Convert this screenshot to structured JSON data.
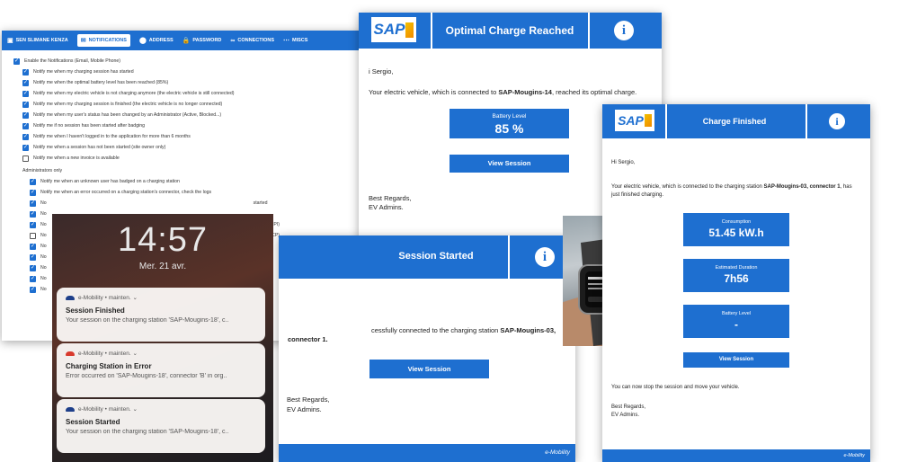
{
  "settings": {
    "tabs": [
      {
        "icon": "▣",
        "label": "SEN SLIMANE KENZA"
      },
      {
        "icon": "✉",
        "label": "NOTIFICATIONS"
      },
      {
        "icon": "⬤",
        "label": "ADDRESS"
      },
      {
        "icon": "🔒",
        "label": "PASSWORD"
      },
      {
        "icon": "∞",
        "label": "CONNECTIONS"
      },
      {
        "icon": "⋯",
        "label": "MISCS"
      }
    ],
    "enable_label": "Enable the Notifications (Email, Mobile Phone)",
    "user_items": [
      {
        "checked": true,
        "label": "Notify me when my charging session has started"
      },
      {
        "checked": true,
        "label": "Notify me when the optimal battery level has been reached (85%)"
      },
      {
        "checked": true,
        "label": "Notify me when my electric vehicle is not charging anymore (the electric vehicle is still connected)"
      },
      {
        "checked": true,
        "label": "Notify me when my charging session is finished (the electric vehicle is no longer connected)"
      },
      {
        "checked": true,
        "label": "Notify me when my user's status has been changed by an Administrator (Active, Blocked...)"
      },
      {
        "checked": true,
        "label": "Notify me if no session has been started after badging"
      },
      {
        "checked": true,
        "label": "Notify me when I haven't logged in to the application for more than 6 months"
      },
      {
        "checked": true,
        "label": "Notify me when a session has not been started (site owner only)"
      },
      {
        "checked": false,
        "label": "Notify me when a new invoice is available"
      }
    ],
    "admin_heading": "Administrators only",
    "admin_items": [
      {
        "checked": true,
        "label": "Notify me when an unknown user has badged on a charging station"
      },
      {
        "checked": true,
        "label": "Notify me when an error occurred on a charging station's connector, check the logs"
      },
      {
        "checked": true,
        "label": "No",
        "tail": "started"
      },
      {
        "checked": true,
        "label": "No",
        "tail": ""
      },
      {
        "checked": true,
        "label": "No",
        "tail": "tform (OCPI)"
      },
      {
        "checked": false,
        "label": "No",
        "tail": "tform (OICP)"
      },
      {
        "checked": true,
        "label": "No",
        "tail": ""
      },
      {
        "checked": true,
        "label": "No",
        "tail": ""
      },
      {
        "checked": true,
        "label": "No",
        "tail": ""
      },
      {
        "checked": true,
        "label": "No",
        "tail": ""
      },
      {
        "checked": true,
        "label": "No",
        "tail": ""
      }
    ]
  },
  "lockscreen": {
    "time": "14:57",
    "date": "Mer. 21 avr.",
    "notifications": [
      {
        "app": "e-Mobility • mainten.",
        "title": "Session Finished",
        "body": "Your session on the charging station 'SAP-Mougins-18', c..",
        "color": "#1e3f8a"
      },
      {
        "app": "e-Mobility • mainten.",
        "title": "Charging Station in Error",
        "body": "Error occurred on 'SAP-Mougins-18', connector 'B' in org..",
        "color": "#d83a2e"
      },
      {
        "app": "e-Mobility • mainten.",
        "title": "Session Started",
        "body": "Your session on the charging station 'SAP-Mougins-18', c..",
        "color": "#1e3f8a"
      }
    ]
  },
  "mail_optimal": {
    "logo": "SAP",
    "title": "Optimal Charge Reached",
    "greeting": "i Sergio,",
    "line_pre": "Your electric vehicle, which is connected to ",
    "line_station": "SAP-Mougins-14",
    "line_post": ", reached its optimal charge.",
    "battery_label": "Battery Level",
    "battery_value": "85 %",
    "button": "View Session",
    "regards": "Best Regards,",
    "signature": "EV Admins."
  },
  "mail_started": {
    "title": "Session Started",
    "line_pre": "cessfully connected to the charging station ",
    "line_station": "SAP-Mougins-03,",
    "connector": "connector 1.",
    "button": "View Session",
    "regards": "Best Regards,",
    "signature": "EV Admins.",
    "footer": "e-Mobility"
  },
  "mail_finished": {
    "logo": "SAP",
    "title": "Charge Finished",
    "greeting": "Hi Sergio,",
    "line_pre": "Your electric vehicle, which is connected to the charging station ",
    "line_station": "SAP-Mougins-03,",
    "line_connector": "connector 1",
    "line_post": ", has just finished charging.",
    "consumption_label": "Consumption",
    "consumption_value": "51.45 kW.h",
    "duration_label": "Estimated Duration",
    "duration_value": "7h56",
    "battery_label": "Battery Level",
    "battery_value": "-",
    "button": "View Session",
    "closing": "You can now stop the session and move your vehicle.",
    "regards": "Best Regards,",
    "signature": "EV Admins.",
    "footer": "e-Mobility"
  },
  "colors": {
    "brand_blue": "#1e6fd0",
    "alert_red": "#d83a2e"
  }
}
